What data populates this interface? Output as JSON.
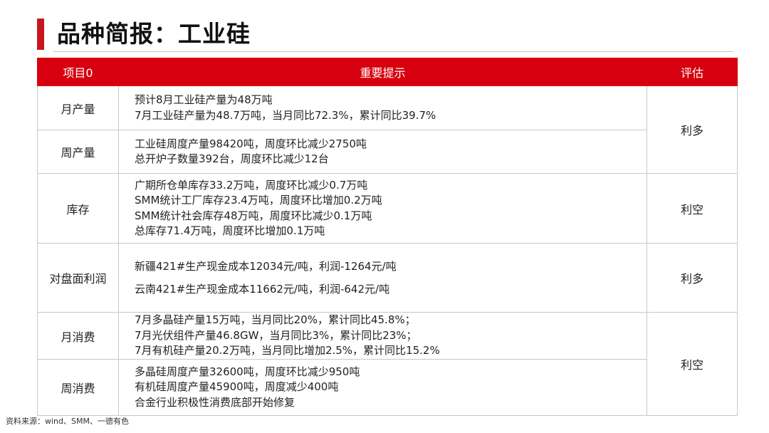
{
  "title": "品种简报：工业硅",
  "table": {
    "headers": [
      "项目0",
      "重要提示",
      "评估"
    ],
    "rows": [
      {
        "item": "月产量",
        "lines": [
          "预计8月工业硅产量为48万吨",
          "7月工业硅产量为48.7万吨，当月同比72.3%，累计同比39.7%"
        ]
      },
      {
        "item": "周产量",
        "lines": [
          "工业硅周度产量98420吨，周度环比减少2750吨",
          "总开炉子数量392台，周度环比减少12台"
        ]
      },
      {
        "item": "库存",
        "lines": [
          "广期所仓单库存33.2万吨，周度环比减少0.7万吨",
          "SMM统计工厂库存23.4万吨，周度环比增加0.2万吨",
          "SMM统计社会库存48万吨，周度环比减少0.1万吨",
          "总库存71.4万吨，周度环比增加0.1万吨"
        ]
      },
      {
        "item": "对盘面利润",
        "lines": [
          "新疆421#生产现金成本12034元/吨，利润-1264元/吨",
          "云南421#生产现金成本11662元/吨，利润-642元/吨"
        ]
      },
      {
        "item": "月消费",
        "lines": [
          "7月多晶硅产量15万吨，当月同比20%，累计同比45.8%；",
          "7月光伏组件产量46.8GW，当月同比3%，累计同比23%；",
          "7月有机硅产量20.2万吨，当月同比增加2.5%，累计同比15.2%"
        ]
      },
      {
        "item": "周消费",
        "lines": [
          "多晶硅周度产量32600吨，周度环比减少950吨",
          "有机硅周度产量45900吨，周度减少400吨",
          "合金行业积极性消费底部开始修复"
        ]
      }
    ],
    "ratings": [
      "利多",
      "利空",
      "利多",
      "利空"
    ]
  },
  "source": "资料来源：wind、SMM、一德有色",
  "colors": {
    "accent": "#c8161d",
    "header_bg": "#d7000f"
  }
}
